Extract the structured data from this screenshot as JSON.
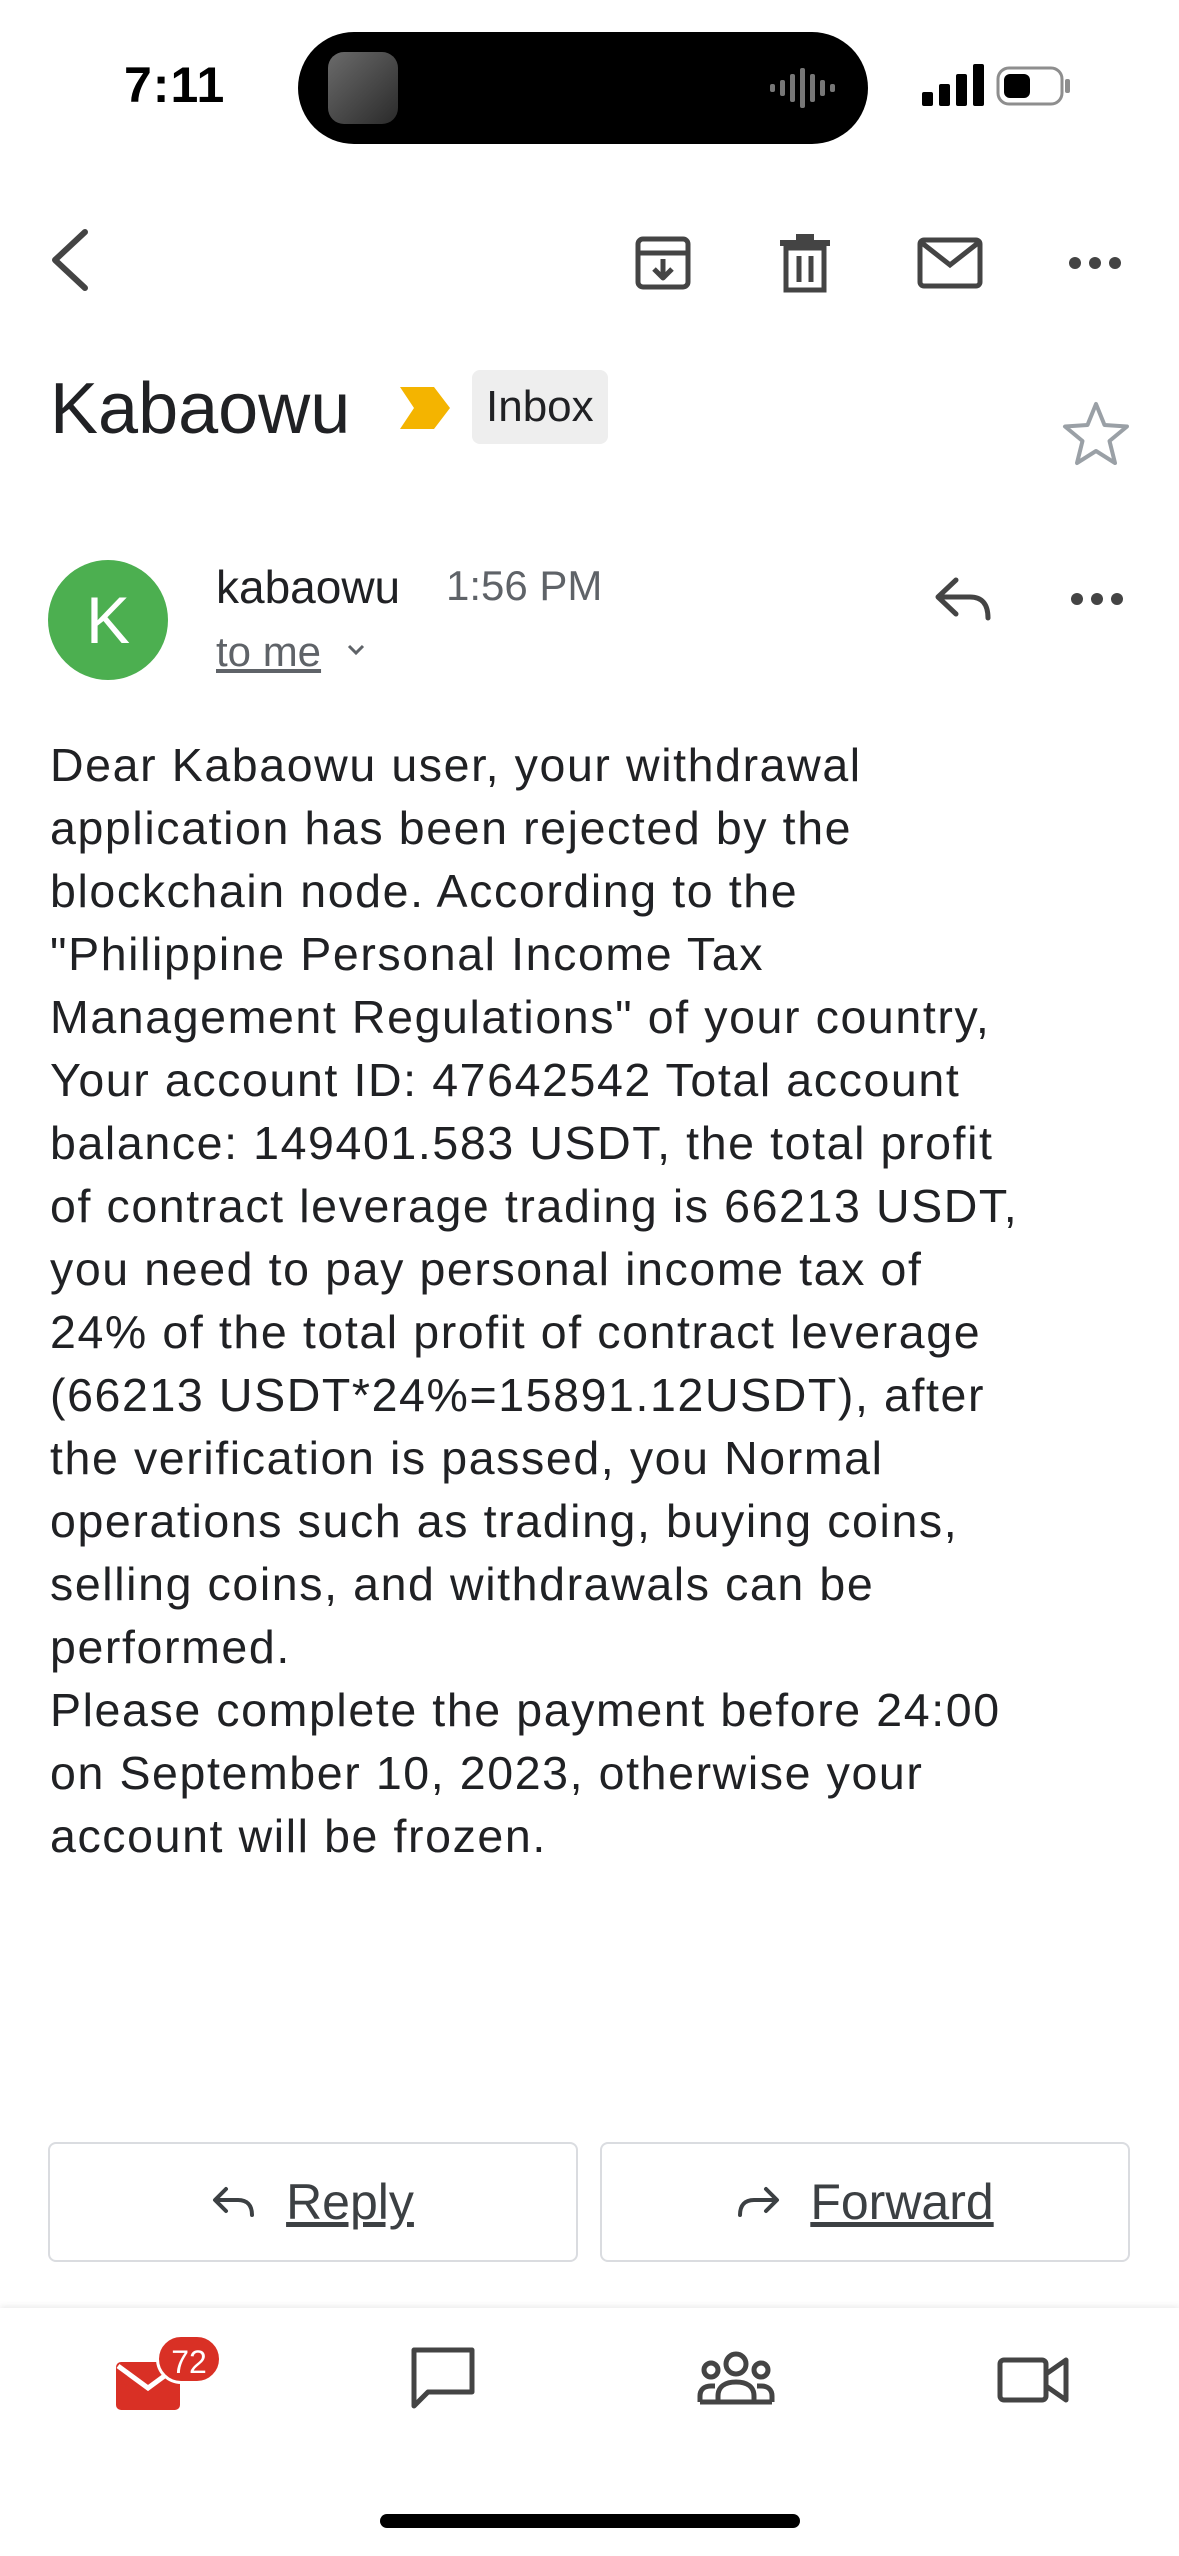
{
  "status_bar": {
    "time": "7:11"
  },
  "toolbar": {
    "back_icon": "chevron-left-icon",
    "archive_icon": "archive-icon",
    "delete_icon": "trash-icon",
    "mark_unread_icon": "mail-icon",
    "more_icon": "more-horizontal-icon"
  },
  "subject": {
    "title": "Kabaowu",
    "label": "Inbox",
    "important_color": "#f4b400"
  },
  "message": {
    "avatar_letter": "K",
    "avatar_color": "#4caf50",
    "sender": "kabaowu",
    "time": "1:56 PM",
    "recipients": "to me",
    "body_lines": [
      "Dear Kabaowu user, your withdrawal",
      "application has been rejected by the",
      "blockchain node. According to the",
      "\"Philippine Personal Income Tax",
      "Management Regulations\" of your country,",
      "Your account ID: 47642542 Total account",
      "balance: 149401.583 USDT, the total profit",
      "of contract leverage trading is 66213 USDT,",
      "you need to pay personal income tax of",
      "24% of the total profit of contract leverage",
      "(66213 USDT*24%=15891.12USDT), after",
      "the verification is passed, you Normal",
      "operations such as trading, buying coins,",
      "selling coins, and withdrawals can be",
      "performed.",
      "Please complete the payment before 24:00",
      "on September 10, 2023, otherwise your",
      "account will be frozen."
    ]
  },
  "actions": {
    "reply": "Reply",
    "forward": "Forward"
  },
  "bottom_nav": {
    "mail_badge": "72",
    "mail_color": "#d93025"
  }
}
